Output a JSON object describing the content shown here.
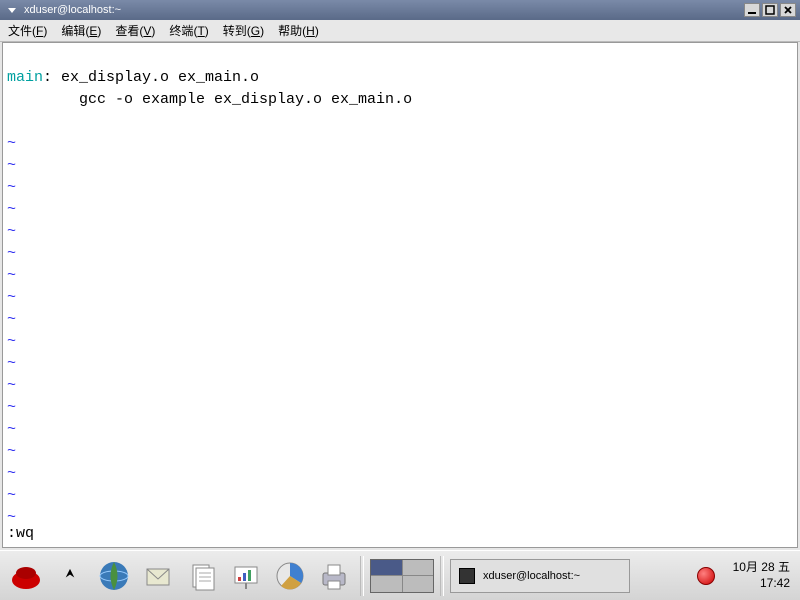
{
  "window": {
    "title": "xduser@localhost:~"
  },
  "menubar": {
    "items": [
      {
        "label": "文件",
        "accel": "F"
      },
      {
        "label": "编辑",
        "accel": "E"
      },
      {
        "label": "查看",
        "accel": "V"
      },
      {
        "label": "终端",
        "accel": "T"
      },
      {
        "label": "转到",
        "accel": "G"
      },
      {
        "label": "帮助",
        "accel": "H"
      }
    ]
  },
  "terminal": {
    "line1_keyword": "main",
    "line1_rest": ": ex_display.o ex_main.o",
    "line2": "        gcc -o example ex_display.o ex_main.o",
    "tilde": "~",
    "command": ":wq"
  },
  "taskbar": {
    "task_label": "xduser@localhost:~",
    "clock_date": "10月 28 五",
    "clock_time": "17:42"
  }
}
